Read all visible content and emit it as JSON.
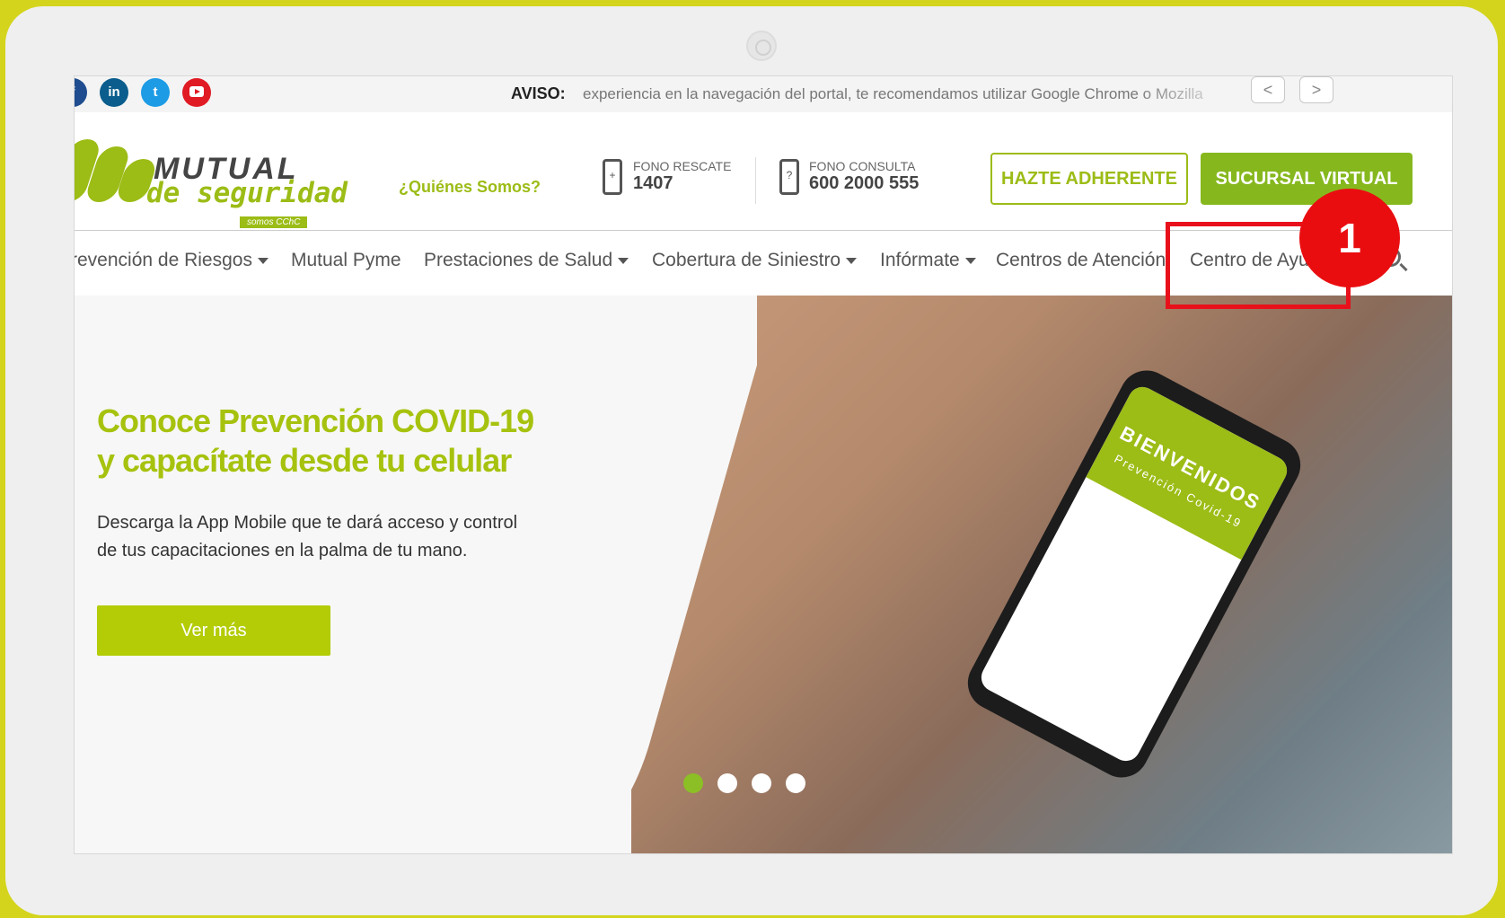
{
  "topbar": {
    "social": [
      {
        "name": "facebook",
        "icon": "facebook-icon",
        "glyph": "f",
        "color": "#1f4d8f"
      },
      {
        "name": "linkedin",
        "icon": "linkedin-icon",
        "glyph": "in",
        "color": "#0a5d8c"
      },
      {
        "name": "twitter",
        "icon": "twitter-icon",
        "glyph": "t",
        "color": "#1d9be5"
      },
      {
        "name": "youtube",
        "icon": "youtube-icon",
        "glyph": "",
        "color": "#e01b24"
      }
    ],
    "aviso_label": "AVISO:",
    "aviso_text": "experiencia en la navegación del portal, te recomendamos utilizar Google Chrome o Mozilla",
    "prev_glyph": "<",
    "next_glyph": ">"
  },
  "header": {
    "logo": {
      "word": "MUTUAL",
      "sub": "de seguridad",
      "tag": "somos CChC"
    },
    "quienes": "¿Quiénes Somos?",
    "fono_rescate": {
      "label": "FONO RESCATE",
      "number": "1407",
      "icon_glyph": "+"
    },
    "fono_consulta": {
      "label": "FONO CONSULTA",
      "number": "600 2000 555",
      "icon_glyph": "?"
    },
    "btn_adherente": "HAZTE ADHERENTE",
    "btn_sucursal": "SUCURSAL VIRTUAL"
  },
  "nav": {
    "items": [
      {
        "label": "revención de Riesgos",
        "has_dropdown": true
      },
      {
        "label": "Mutual Pyme",
        "has_dropdown": false
      },
      {
        "label": "Prestaciones de Salud",
        "has_dropdown": true
      },
      {
        "label": "Cobertura de Siniestro",
        "has_dropdown": true
      },
      {
        "label": "Infórmate",
        "has_dropdown": true
      },
      {
        "label": "Centros de Atención",
        "has_dropdown": false
      },
      {
        "label": "Centro de Ayuda",
        "has_dropdown": false
      }
    ]
  },
  "hero": {
    "title_line1": "Conoce Prevención COVID-19",
    "title_line2": "y capacítate desde tu celular",
    "desc_line1": "Descarga la App Mobile que te dará acceso y control",
    "desc_line2": "de tus capacitaciones en la palma de tu mano.",
    "button": "Ver más",
    "phone_text": "BIENVENIDOS",
    "phone_sub": "Prevención Covid-19",
    "slides": 4,
    "active_slide": 1
  },
  "annotation": {
    "number": "1",
    "color": "#ea0d10"
  },
  "colors": {
    "brand_green": "#9cbc16",
    "button_green": "#86b81e",
    "border": "#d4d41c"
  }
}
